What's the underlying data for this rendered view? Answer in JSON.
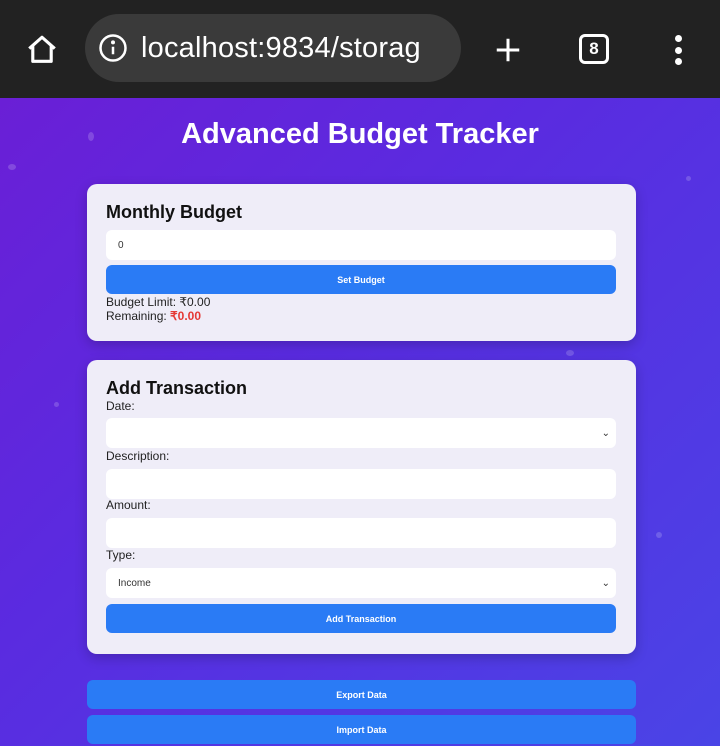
{
  "browser": {
    "url": "localhost:9834/storag",
    "tab_count": "8"
  },
  "page": {
    "title": "Advanced Budget Tracker"
  },
  "budget": {
    "heading": "Monthly Budget",
    "input_value": "0",
    "set_button": "Set Budget",
    "limit_label": "Budget Limit: ₹0.00",
    "remaining_label": "Remaining: ",
    "remaining_value": "₹0.00",
    "remaining_color": "#e53935"
  },
  "transaction": {
    "heading": "Add Transaction",
    "date_label": "Date:",
    "description_label": "Description:",
    "amount_label": "Amount:",
    "type_label": "Type:",
    "type_selected": "Income",
    "add_button": "Add Transaction"
  },
  "actions": {
    "export_button": "Export Data",
    "import_button": "Import Data"
  },
  "colors": {
    "accent": "#2a7bf5",
    "background_start": "#6a1fd6",
    "background_end": "#4a44e6"
  }
}
